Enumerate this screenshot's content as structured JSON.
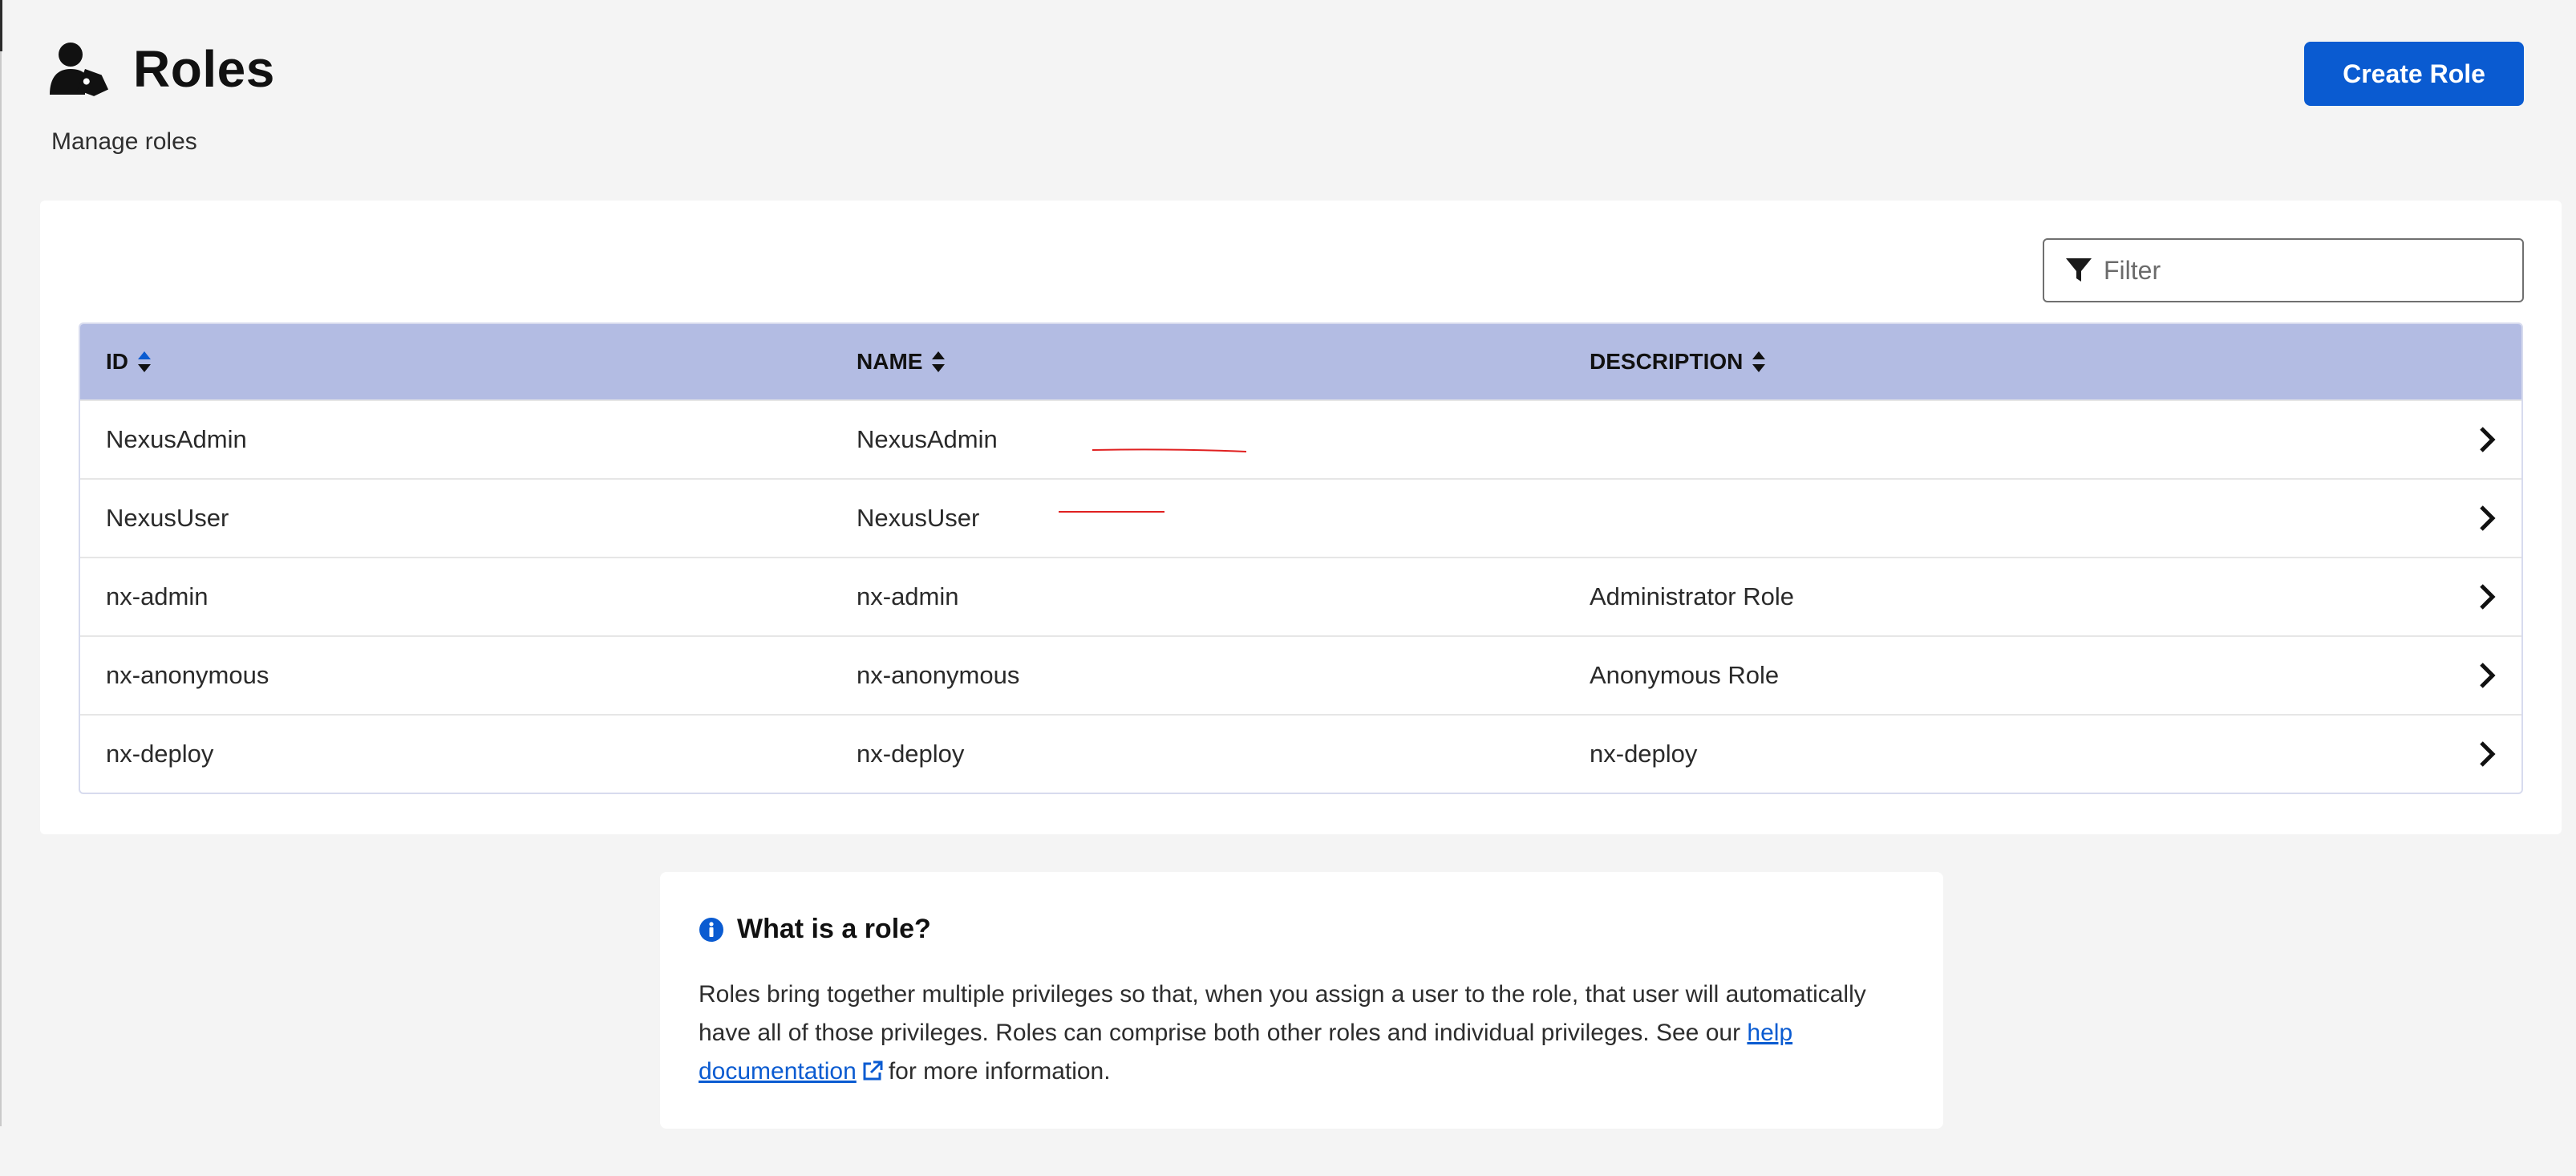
{
  "header": {
    "title": "Roles",
    "subtitle": "Manage roles",
    "icon": "user-tag-icon",
    "create_button_label": "Create Role"
  },
  "filter": {
    "placeholder": "Filter",
    "icon": "filter-icon"
  },
  "table": {
    "columns": [
      {
        "label": "ID",
        "sort": "ascending-active"
      },
      {
        "label": "NAME",
        "sort": "none"
      },
      {
        "label": "DESCRIPTION",
        "sort": "none"
      }
    ],
    "rows": [
      {
        "id": "NexusAdmin",
        "name": "NexusAdmin",
        "description": ""
      },
      {
        "id": "NexusUser",
        "name": "NexusUser",
        "description": ""
      },
      {
        "id": "nx-admin",
        "name": "nx-admin",
        "description": "Administrator Role"
      },
      {
        "id": "nx-anonymous",
        "name": "nx-anonymous",
        "description": "Anonymous Role"
      },
      {
        "id": "nx-deploy",
        "name": "nx-deploy",
        "description": "nx-deploy"
      }
    ]
  },
  "info": {
    "title": "What is a role?",
    "body_prefix": "Roles bring together multiple privileges so that, when you assign a user to the role, that user will automatically have all of those privileges. Roles can comprise both other roles and individual privileges. See our",
    "link_label": "help documentation",
    "body_suffix": "for more information."
  },
  "colors": {
    "accent": "#0a5bd1",
    "table_header": "#b3bce3",
    "background": "#f4f4f4",
    "annotation": "#e02020"
  }
}
